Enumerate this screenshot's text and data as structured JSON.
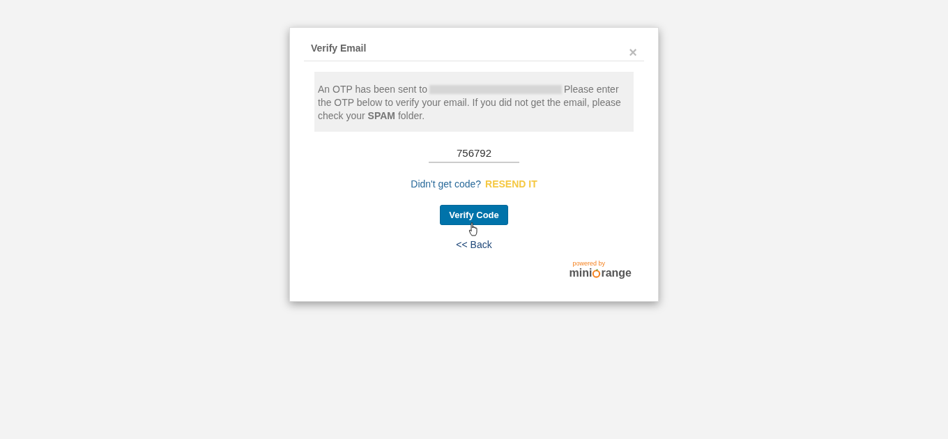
{
  "dialog": {
    "title": "Verify Email",
    "close": "×"
  },
  "message": {
    "before": "An OTP has been sent to",
    "after": "Please enter the OTP below to verify your email. If you did not get the email, please check your **SPAM** folder.",
    "email_redacted": true
  },
  "otp_field": {
    "value": "756792"
  },
  "resend": {
    "prompt": "Didn't get code?",
    "link": "RESEND IT"
  },
  "verify_button": {
    "label": "Verify Code"
  },
  "back_link": {
    "label": "<< Back"
  },
  "branding": {
    "caption": "powered by",
    "prefix": "mini",
    "suffix": "range"
  }
}
